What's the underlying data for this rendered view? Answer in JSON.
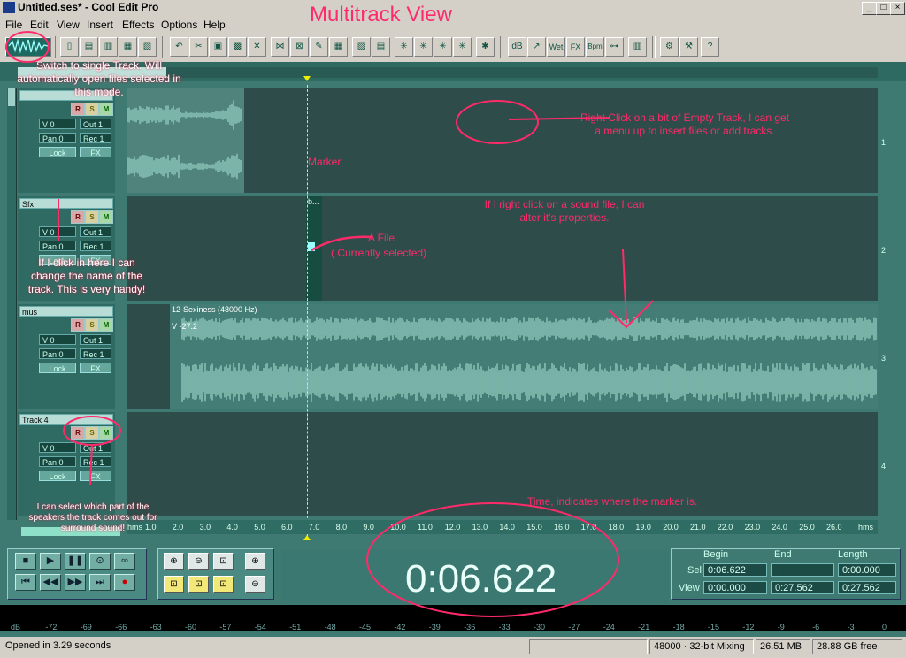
{
  "window": {
    "title": "Untitled.ses* - Cool Edit Pro",
    "min": "_",
    "max": "□",
    "close": "×"
  },
  "menu": [
    "File",
    "Edit",
    "View",
    "Insert",
    "Effects",
    "Options",
    "Help"
  ],
  "toolbar_text": {
    "wet": "Wet",
    "fx": "FX",
    "bpm": "Bpm",
    "db": "dB"
  },
  "tracks": [
    {
      "name": "",
      "vol": "V 0",
      "pan": "Pan 0",
      "out": "Out 1",
      "rec": "Rec 1",
      "lock": "Lock",
      "fx": "FX",
      "num": "1"
    },
    {
      "name": "Sfx",
      "vol": "V 0",
      "pan": "Pan 0",
      "out": "Out 1",
      "rec": "Rec 1",
      "lock": "Lock",
      "fx": "FX",
      "num": "2"
    },
    {
      "name": "mus",
      "vol": "V 0",
      "pan": "Pan 0",
      "out": "Out 1",
      "rec": "Rec 1",
      "lock": "Lock",
      "fx": "FX",
      "num": "3"
    },
    {
      "name": "Track 4",
      "vol": "V 0",
      "pan": "Pan 0",
      "out": "Out 1",
      "rec": "Rec 1",
      "lock": "Lock",
      "fx": "FX",
      "num": "4"
    }
  ],
  "rsm": {
    "r": "R",
    "s": "S",
    "m": "M"
  },
  "clips": {
    "sfx_caption": "b...",
    "music_caption": "12-Sexiness (48000 Hz)",
    "music_vol": "V -27.2"
  },
  "ruler": {
    "ticks": [
      "hms",
      "1.0",
      "2.0",
      "3.0",
      "4.0",
      "5.0",
      "6.0",
      "7.0",
      "8.0",
      "9.0",
      "10.0",
      "11.0",
      "12.0",
      "13.0",
      "14.0",
      "15.0",
      "16.0",
      "17.0",
      "18.0",
      "19.0",
      "20.0",
      "21.0",
      "22.0",
      "23.0",
      "24.0",
      "25.0",
      "26.0",
      "hms"
    ]
  },
  "time": {
    "display": "0:06.622",
    "begin_label": "Begin",
    "end_label": "End",
    "length_label": "Length",
    "sel_label": "Sel",
    "view_label": "View",
    "sel_begin": "0:06.622",
    "sel_end": "",
    "sel_length": "0:00.000",
    "view_begin": "0:00.000",
    "view_end": "0:27.562",
    "view_length": "0:27.562"
  },
  "meter": {
    "ticks": [
      "dB",
      "-72",
      "-69",
      "-66",
      "-63",
      "-60",
      "-57",
      "-54",
      "-51",
      "-48",
      "-45",
      "-42",
      "-39",
      "-36",
      "-33",
      "-30",
      "-27",
      "-24",
      "-21",
      "-18",
      "-15",
      "-12",
      "-9",
      "-6",
      "-3",
      "0"
    ]
  },
  "status": {
    "opened": "Opened in 3.29 seconds",
    "mixing": "48000 · 32-bit Mixing",
    "mem": "26.51 MB",
    "free": "28.88 GB free"
  },
  "annotations": {
    "heading": "Multitrack View",
    "switch": "Switch to single Track. Will automatically open files selected in this mode.",
    "right_click": "Right Click on a bit of Empty Track, I can get a menu up to insert files or add tracks.",
    "marker": "Marker",
    "properties": "If I right click on a sound file, I can alter it's properties.",
    "afile_1": "A File",
    "afile_2": "( Currently selected)",
    "rename": "If I click in here I can change the name of the track. This is very handy!",
    "speakers": "I can select which part of the speakers the track comes out for surround sound!",
    "time": "Time, indicates where the marker is."
  },
  "colors": {
    "annotation": "#ff2a6a",
    "panel": "#3e7a72",
    "waveform": "#8fc9bd"
  }
}
